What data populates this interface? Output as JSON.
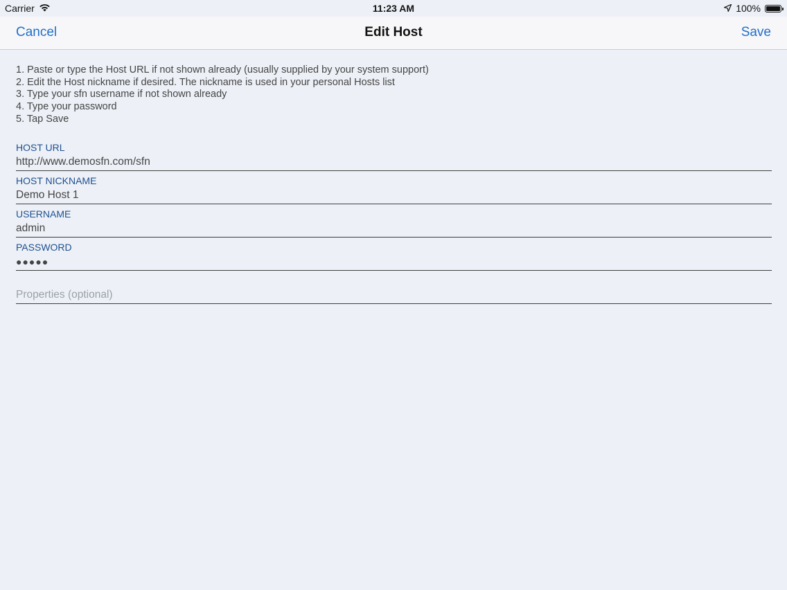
{
  "status_bar": {
    "carrier": "Carrier",
    "time": "11:23 AM",
    "battery": "100%",
    "battery_level": 1.0,
    "icons": [
      "wifi-icon",
      "location-arrow-icon",
      "battery-icon"
    ]
  },
  "nav": {
    "cancel_label": "Cancel",
    "title": "Edit Host",
    "save_label": "Save",
    "accent_color": "#1f6fc9"
  },
  "instructions": [
    "1. Paste or type the Host URL if not shown already (usually supplied by your system support)",
    "2. Edit the Host nickname if desired. The nickname is used in your personal Hosts list",
    "3. Type your sfn username if not shown already",
    "4. Type your password",
    "5. Tap Save"
  ],
  "form": {
    "host_url": {
      "label": "HOST URL",
      "value": "http://www.demosfn.com/sfn"
    },
    "host_nickname": {
      "label": "HOST NICKNAME",
      "value": "Demo Host 1"
    },
    "username": {
      "label": "USERNAME",
      "value": "admin"
    },
    "password": {
      "label": "PASSWORD",
      "value": "●●●●●"
    },
    "properties": {
      "placeholder": "Properties (optional)",
      "value": ""
    }
  }
}
